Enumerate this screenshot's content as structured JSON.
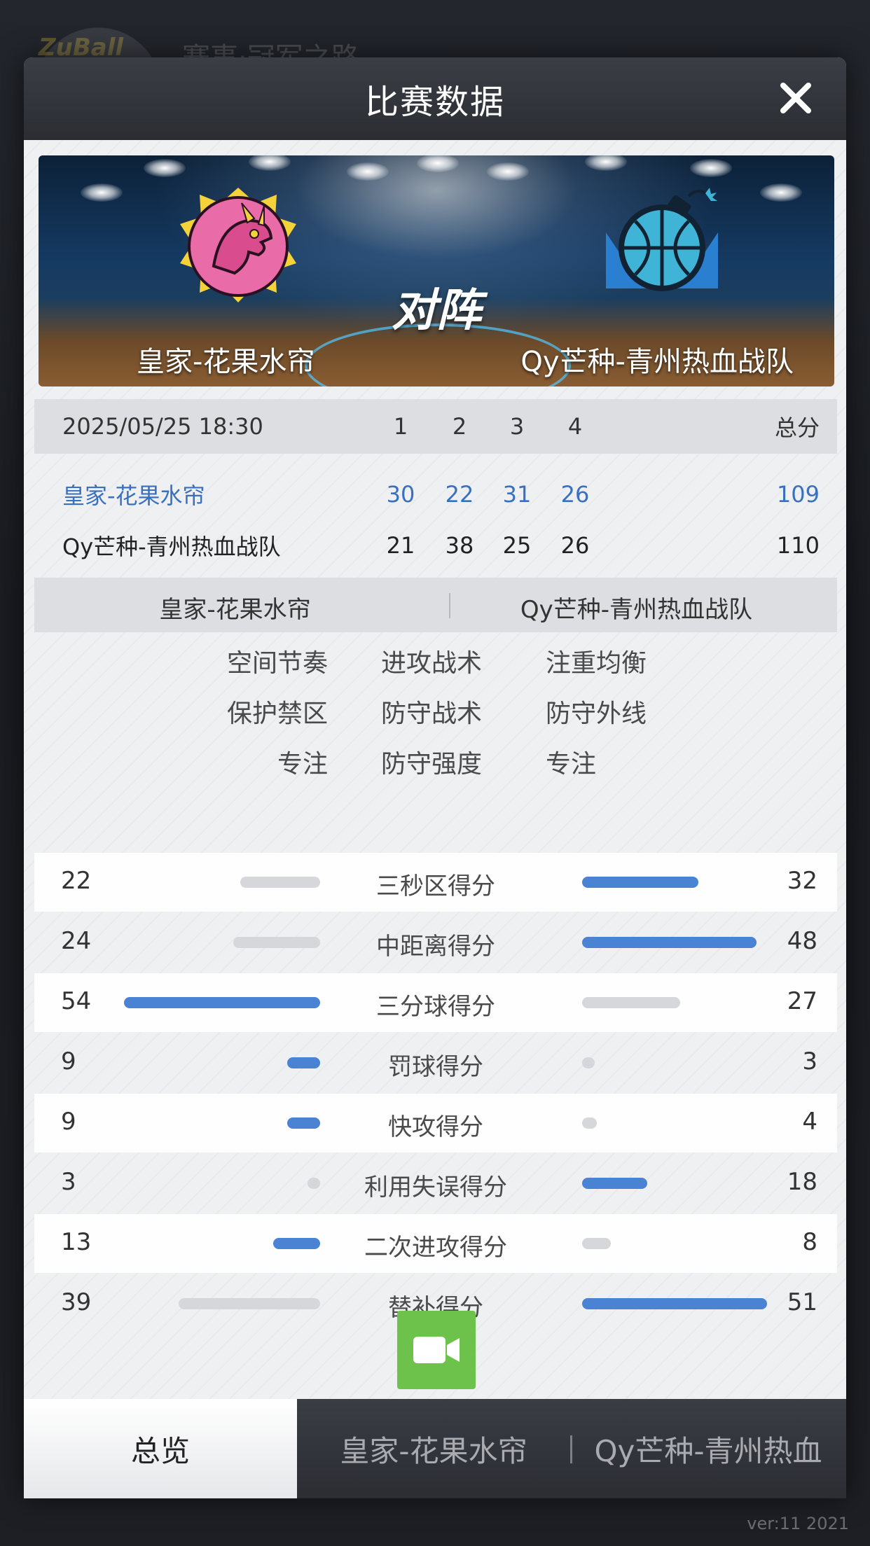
{
  "background": {
    "app_title": "赛事·冠军之路",
    "logo_text": "ZuBall"
  },
  "version": "ver:11  2021",
  "modal": {
    "title": "比赛数据"
  },
  "banner": {
    "vs_text": "对阵",
    "home_team": "皇家-花果水帘",
    "away_team": "Qy芒种-青州热血战队"
  },
  "score_table": {
    "datetime": "2025/05/25 18:30",
    "quarters": [
      "1",
      "2",
      "3",
      "4"
    ],
    "total_label": "总分",
    "rows": [
      {
        "team": "皇家-花果水帘",
        "q": [
          "30",
          "22",
          "31",
          "26"
        ],
        "total": "109"
      },
      {
        "team": "Qy芒种-青州热血战队",
        "q": [
          "21",
          "38",
          "25",
          "26"
        ],
        "total": "110"
      }
    ]
  },
  "tactics": {
    "home_team": "皇家-花果水帘",
    "away_team": "Qy芒种-青州热血战队",
    "rows": [
      {
        "home": "空间节奏",
        "label": "进攻战术",
        "away": "注重均衡"
      },
      {
        "home": "保护禁区",
        "label": "防守战术",
        "away": "防守外线"
      },
      {
        "home": "专注",
        "label": "防守强度",
        "away": "专注"
      }
    ]
  },
  "stats": [
    {
      "label": "三秒区得分",
      "home": 22,
      "away": 32
    },
    {
      "label": "中距离得分",
      "home": 24,
      "away": 48
    },
    {
      "label": "三分球得分",
      "home": 54,
      "away": 27
    },
    {
      "label": "罚球得分",
      "home": 9,
      "away": 3
    },
    {
      "label": "快攻得分",
      "home": 9,
      "away": 4
    },
    {
      "label": "利用失误得分",
      "home": 3,
      "away": 18
    },
    {
      "label": "二次进攻得分",
      "home": 13,
      "away": 8
    },
    {
      "label": "替补得分",
      "home": 39,
      "away": 51
    }
  ],
  "colors": {
    "win_bar": "#4a82d4",
    "lose_bar": "#d6d7da",
    "home_accent": "#3a70c0",
    "video_button": "#6cc24a"
  },
  "tabs": {
    "overview": "总览",
    "home": "皇家-花果水帘",
    "away": "Qy芒种-青州热血"
  },
  "icons": {
    "close": "close-icon",
    "video": "video-camera-icon"
  }
}
